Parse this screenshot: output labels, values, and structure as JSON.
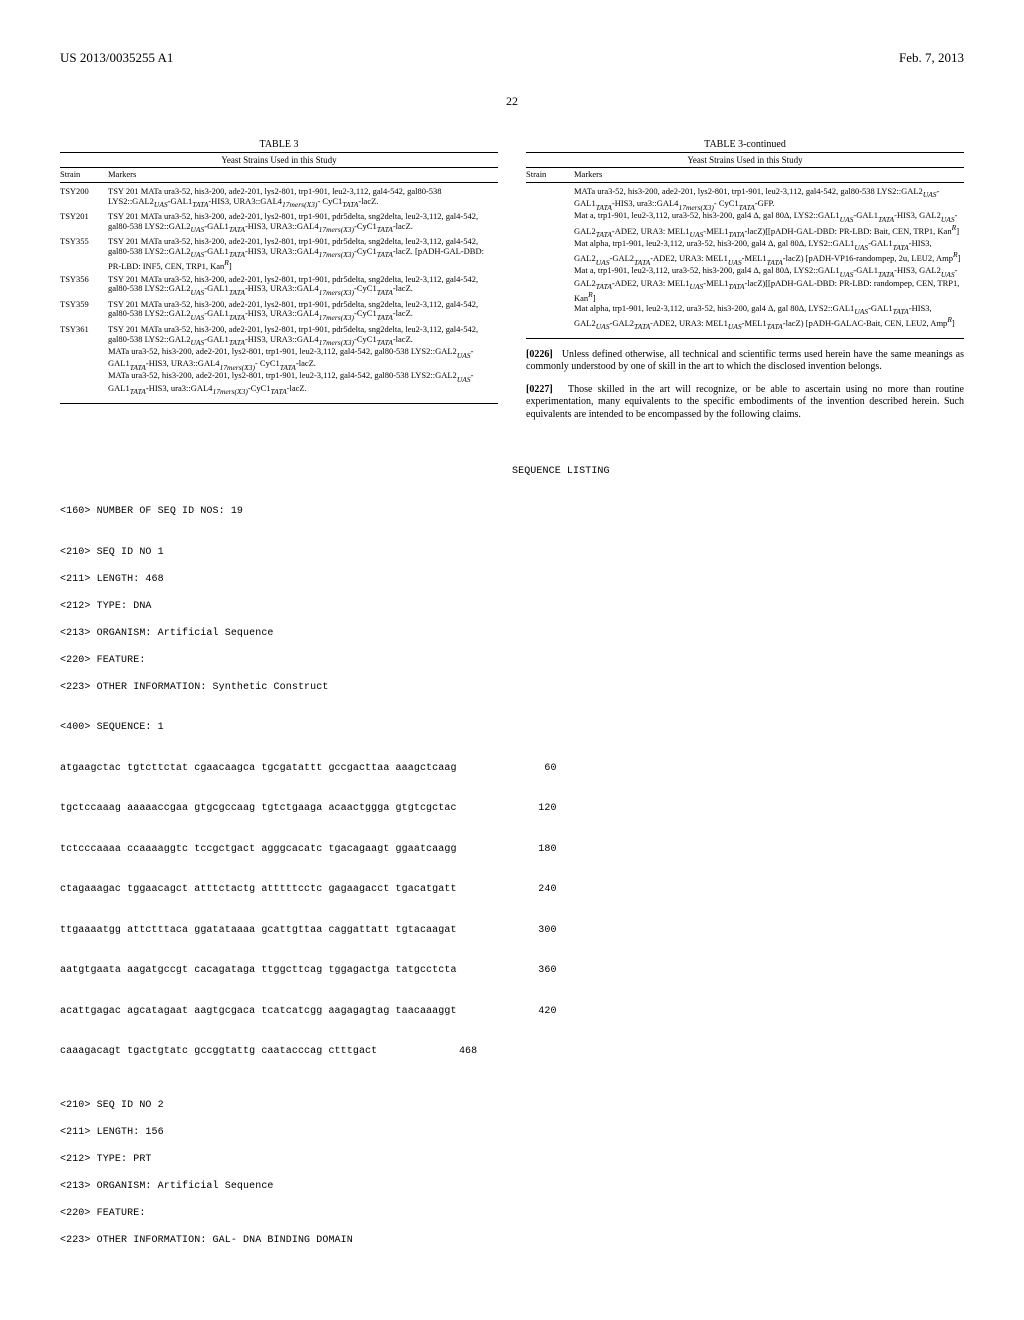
{
  "header": {
    "left": "US 2013/0035255 A1",
    "right": "Feb. 7, 2013"
  },
  "page_number": "22",
  "table_left": {
    "title": "TABLE 3",
    "caption": "Yeast Strains Used in this Study",
    "col_headers": [
      "Strain",
      "Markers"
    ],
    "rows": [
      {
        "strain": "TSY200",
        "markers": "TSY 201 MATa ura3-52, his3-200, ade2-201, lys2-801, trp1-901, leu2-3,112, gal4-542, gal80-538 LYS2::GAL2_UAS-GAL1_TATA-HIS3, URA3::GAL4_17mers(X3)- CyC1_TATA-lacZ."
      },
      {
        "strain": "TSY201",
        "markers": "TSY 201 MATa ura3-52, his3-200, ade2-201, lys2-801, trp1-901, pdr5delta, sng2delta, leu2-3,112, gal4-542, gal80-538 LYS2::GAL2_UAS-GAL1_TATA-HIS3, URA3::GAL4_17mers(X3)-CyC1_TATA-lacZ."
      },
      {
        "strain": "TSY355",
        "markers": "TSY 201 MATa ura3-52, his3-200, ade2-201, lys2-801, trp1-901, pdr5delta, sng2delta, leu2-3,112, gal4-542, gal80-538 LYS2::GAL2_UAS-GAL1_TATA-HIS3, URA3::GAL4_17mers(X3)-CyC1_TATA-lacZ. [pADH-GAL-DBD: PR-LBD: INF5, CEN, TRP1, Kan^R]"
      },
      {
        "strain": "TSY356",
        "markers": "TSY 201 MATa ura3-52, his3-200, ade2-201, lys2-801, trp1-901, pdr5delta, sng2delta, leu2-3,112, gal4-542, gal80-538 LYS2::GAL2_UAS-GAL1_TATA-HIS3, URA3::GAL4_17mers(X3)-CyC1_TATA-lacZ."
      },
      {
        "strain": "TSY359",
        "markers": "TSY 201 MATa ura3-52, his3-200, ade2-201, lys2-801, trp1-901, pdr5delta, sng2delta, leu2-3,112, gal4-542, gal80-538 LYS2::GAL2_UAS-GAL1_TATA-HIS3, URA3::GAL4_17mers(X3)-CyC1_TATA-lacZ."
      },
      {
        "strain": "TSY361",
        "markers": "TSY 201 MATa ura3-52, his3-200, ade2-201, lys2-801, trp1-901, pdr5delta, sng2delta, leu2-3,112, gal4-542, gal80-538 LYS2::GAL2_UAS-GAL1_TATA-HIS3, URA3::GAL4_17mers(X3)-CyC1_TATA-lacZ.\nMATa ura3-52, his3-200, ade2-201, lys2-801, trp1-901, leu2-3,112, gal4-542, gal80-538 LYS2::GAL2_UAS-GAL1_TATA-HIS3, URA3::GAL4_17mers(X3)- CyC1_TATA-lacZ.\nMATa ura3-52, his3-200, ade2-201, lys2-801, trp1-901, leu2-3,112, gal4-542, gal80-538 LYS2::GAL2_UAS-GAL1_TATA-HIS3, ura3::GAL4_17mers(X3)-CyC1_TATA-lacZ."
      }
    ]
  },
  "table_right": {
    "title": "TABLE 3-continued",
    "caption": "Yeast Strains Used in this Study",
    "col_headers": [
      "Strain",
      "Markers"
    ],
    "rows": [
      {
        "strain": "",
        "markers": "MATa ura3-52, his3-200, ade2-201, lys2-801, trp1-901, leu2-3,112, gal4-542, gal80-538 LYS2::GAL2_UAS-GAL1_TATA-HIS3, ura3::GAL4_17mers(X3)- CyC1_TATA-GFP.\nMat a, trp1-901, leu2-3,112, ura3-52, his3-200, gal4 Δ, gal 80Δ, LYS2::GAL1_UAS-GAL1_TATA-HIS3, GAL2_UAS-GAL2_TATA-ADE2, URA3: MEL1_UAS-MEL1_TATA-lacZ)[[pADH-GAL-DBD: PR-LBD: Bait, CEN, TRP1, Kan^R]\nMat alpha, trp1-901, leu2-3,112, ura3-52, his3-200, gal4 Δ, gal 80Δ, LYS2::GAL1_UAS-GAL1_TATA-HIS3, GAL2_UAS-GAL2_TATA-ADE2, URA3: MEL1_UAS-MEL1_TATA-lacZ) [pADH-VP16-randompep, 2u, LEU2, Amp^R]\nMat a, trp1-901, leu2-3,112, ura3-52, his3-200, gal4 Δ, gal 80Δ, LYS2::GAL1_UAS-GAL1_TATA-HIS3, GAL2_UAS-GAL2_TATA-ADE2, URA3: MEL1_UAS-MEL1_TATA-lacZ)[[pADH-GAL-DBD: PR-LBD: randompep, CEN, TRP1, Kan^R]\nMat alpha, trp1-901, leu2-3,112, ura3-52, his3-200, gal4 Δ, gal 80Δ, LYS2::GAL1_UAS-GAL1_TATA-HIS3, GAL2_UAS-GAL2_TATA-ADE2, URA3: MEL1_UAS-MEL1_TATA-lacZ) [pADH-GALAC-Bait, CEN, LEU2, Amp^R]"
      }
    ]
  },
  "paragraphs": [
    {
      "num": "[0226]",
      "text": "Unless defined otherwise, all technical and scientific terms used herein have the same meanings as commonly understood by one of skill in the art to which the disclosed invention belongs."
    },
    {
      "num": "[0227]",
      "text": "Those skilled in the art will recognize, or be able to ascertain using no more than routine experimentation, many equivalents to the specific embodiments of the invention described herein. Such equivalents are intended to be encompassed by the following claims."
    }
  ],
  "sequence_listing": {
    "title": "SEQUENCE LISTING",
    "num_seq_line": "<160> NUMBER OF SEQ ID NOS: 19",
    "records": [
      {
        "header": [
          "<210> SEQ ID NO 1",
          "<211> LENGTH: 468",
          "<212> TYPE: DNA",
          "<213> ORGANISM: Artificial Sequence",
          "<220> FEATURE:",
          "<223> OTHER INFORMATION: Synthetic Construct"
        ],
        "seq_tag": "<400> SEQUENCE: 1",
        "lines": [
          {
            "seq": "atgaagctac tgtcttctat cgaacaagca tgcgatattt gccgacttaa aaagctcaag",
            "pos": "60"
          },
          {
            "seq": "tgctccaaag aaaaaccgaa gtgcgccaag tgtctgaaga acaactggga gtgtcgctac",
            "pos": "120"
          },
          {
            "seq": "tctcccaaaa ccaaaaggtc tccgctgact agggcacatc tgacagaagt ggaatcaagg",
            "pos": "180"
          },
          {
            "seq": "ctagaaagac tggaacagct atttctactg atttttcctc gagaagacct tgacatgatt",
            "pos": "240"
          },
          {
            "seq": "ttgaaaatgg attctttaca ggatataaaa gcattgttaa caggattatt tgtacaagat",
            "pos": "300"
          },
          {
            "seq": "aatgtgaata aagatgccgt cacagataga ttggcttcag tggagactga tatgcctcta",
            "pos": "360"
          },
          {
            "seq": "acattgagac agcatagaat aagtgcgaca tcatcatcgg aagagagtag taacaaaggt",
            "pos": "420"
          },
          {
            "seq": "caaagacagt tgactgtatc gccggtattg caatacccag ctttgact",
            "pos": "468"
          }
        ]
      },
      {
        "header": [
          "<210> SEQ ID NO 2",
          "<211> LENGTH: 156",
          "<212> TYPE: PRT",
          "<213> ORGANISM: Artificial Sequence",
          "<220> FEATURE:",
          "<223> OTHER INFORMATION: GAL- DNA BINDING DOMAIN"
        ]
      }
    ]
  }
}
